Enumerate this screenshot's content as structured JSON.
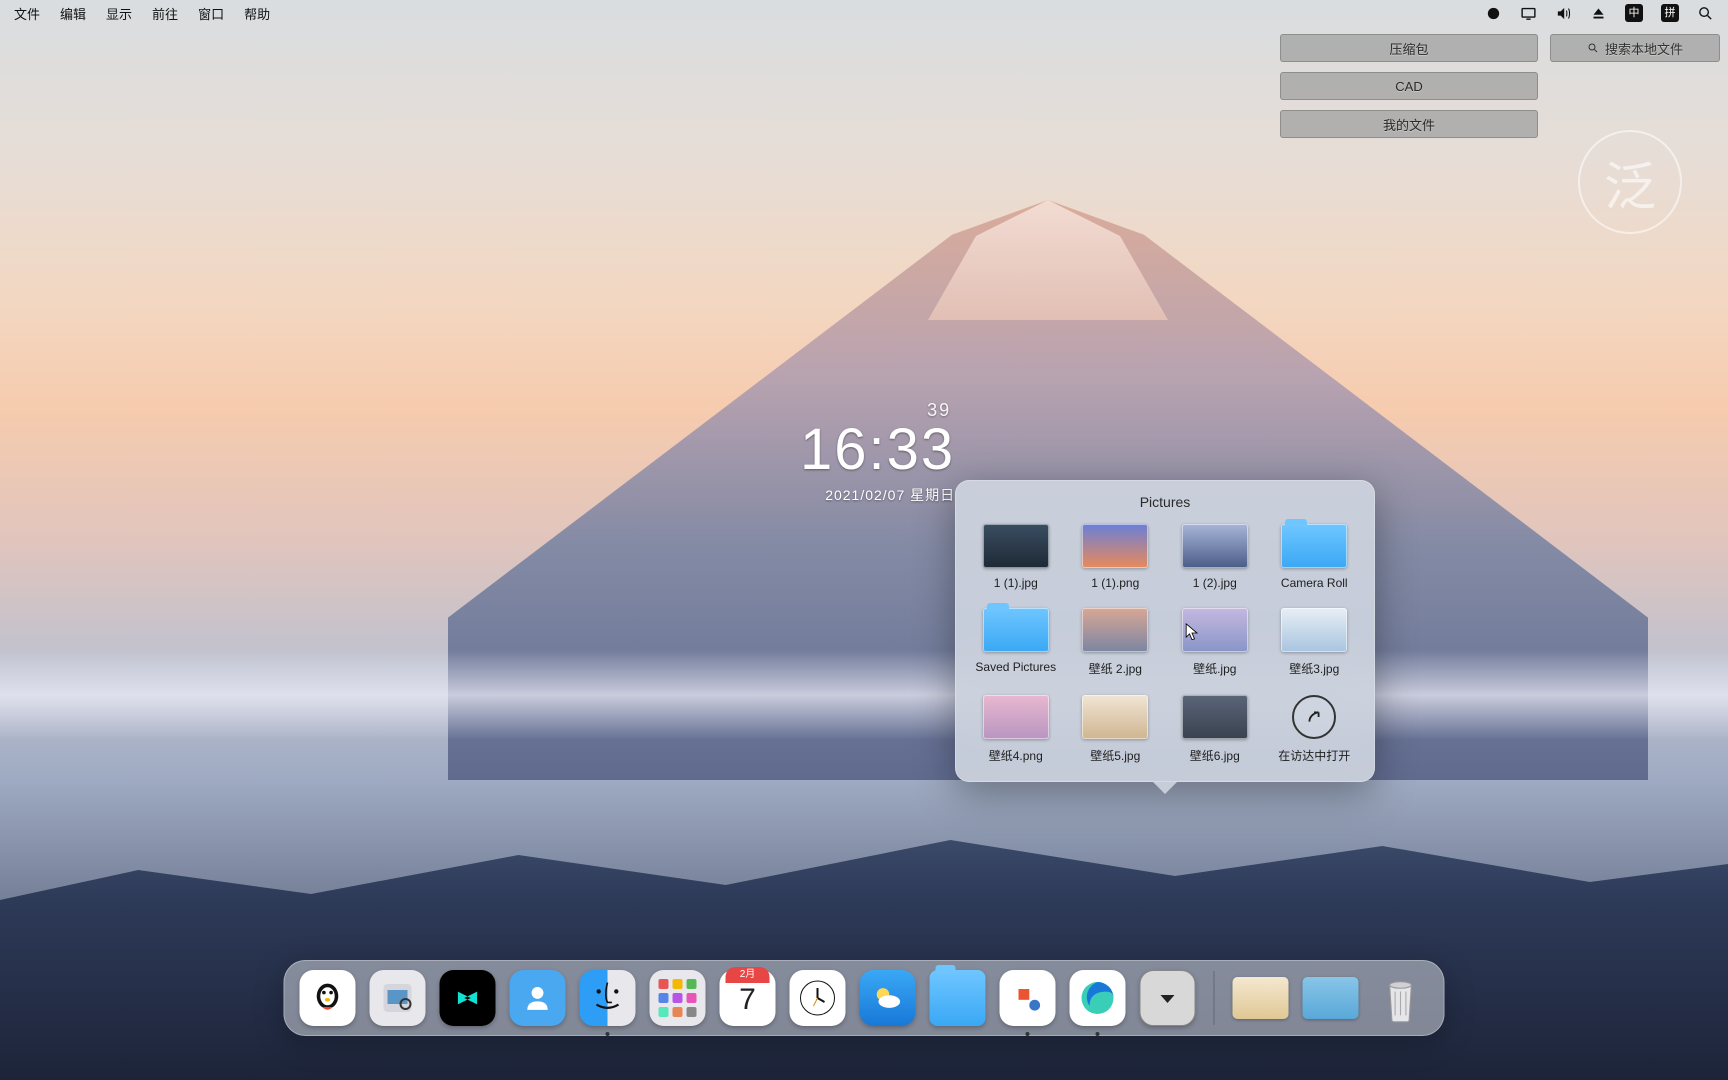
{
  "menubar": {
    "items": [
      "文件",
      "编辑",
      "显示",
      "前往",
      "窗口",
      "帮助"
    ]
  },
  "quick_buttons": {
    "col": [
      "压缩包",
      "CAD",
      "我的文件"
    ],
    "search": "搜索本地文件"
  },
  "watermark": "泛",
  "clock": {
    "seconds": "39",
    "time": "16:33",
    "date": "2021/02/07  星期日"
  },
  "stack": {
    "title": "Pictures",
    "items": [
      {
        "label": "1 (1).jpg",
        "type": "img",
        "bg": "linear-gradient(#3a4d62,#1e2936)"
      },
      {
        "label": "1 (1).png",
        "type": "img",
        "bg": "linear-gradient(#6a7fd8,#e98a5a)"
      },
      {
        "label": "1 (2).jpg",
        "type": "img",
        "bg": "linear-gradient(#a8b5d8,#4a5c88)"
      },
      {
        "label": "Camera Roll",
        "type": "folder"
      },
      {
        "label": "Saved Pictures",
        "type": "folder"
      },
      {
        "label": "壁纸 2.jpg",
        "type": "img",
        "bg": "linear-gradient(#d8a795,#7b85a2)"
      },
      {
        "label": "壁纸.jpg",
        "type": "img",
        "bg": "linear-gradient(#c5b8e0,#8895c8)"
      },
      {
        "label": "壁纸3.jpg",
        "type": "img",
        "bg": "linear-gradient(#e8eef5,#a8c5e0)"
      },
      {
        "label": "壁纸4.png",
        "type": "img",
        "bg": "linear-gradient(#e8b8d0,#b895c0)"
      },
      {
        "label": "壁纸5.jpg",
        "type": "img",
        "bg": "linear-gradient(#f0e5d5,#d0b590)"
      },
      {
        "label": "壁纸6.jpg",
        "type": "img",
        "bg": "linear-gradient(#5a6578,#3a4250)"
      },
      {
        "label": "在访达中打开",
        "type": "open"
      }
    ]
  },
  "dock": {
    "apps": [
      {
        "name": "qq",
        "bg": "#ffffff"
      },
      {
        "name": "preview",
        "bg": "#e8e8ec"
      },
      {
        "name": "capcut",
        "bg": "#000000"
      },
      {
        "name": "contacts",
        "bg": "#4aa8f0"
      },
      {
        "name": "finder",
        "bg": "#2e9df5",
        "running": true
      },
      {
        "name": "launchpad",
        "bg": "#e8e8ec"
      },
      {
        "name": "calendar",
        "bg": "#ffffff",
        "top": "2月",
        "num": "7"
      },
      {
        "name": "clock",
        "bg": "#ffffff"
      },
      {
        "name": "weather",
        "bg": "linear-gradient(#3aa8f5,#1878d8)"
      },
      {
        "name": "pictures-folder",
        "bg": "linear-gradient(#6fc6ff,#3aa8f5)"
      },
      {
        "name": "wps",
        "bg": "#ffffff",
        "running": true
      },
      {
        "name": "edge",
        "bg": "#ffffff",
        "running": true
      },
      {
        "name": "dropdown",
        "bg": "#d8d8d8"
      }
    ],
    "minimized": [
      {
        "name": "min-window-1",
        "bg": "linear-gradient(#f5e8d0,#e0c895)"
      },
      {
        "name": "min-window-2",
        "bg": "linear-gradient(#88c5e8,#5aa8d8)"
      }
    ],
    "trash": "trash"
  }
}
